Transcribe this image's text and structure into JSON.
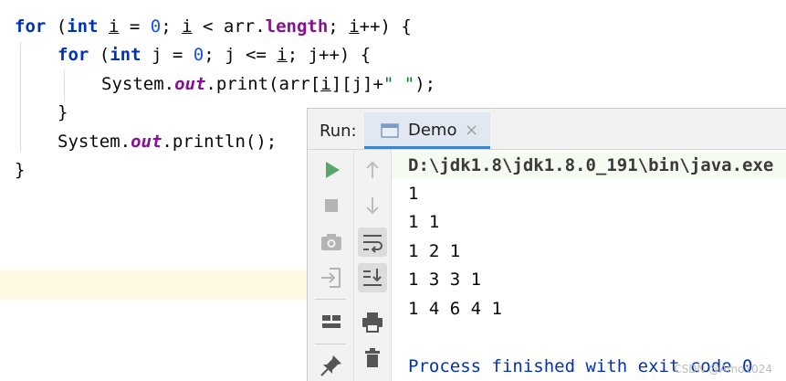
{
  "editor": {
    "line1": {
      "for_kw": "for",
      "open": " (",
      "int_kw": "int",
      "sp1": " ",
      "var_i": "i",
      "assign": " = ",
      "zero": "0",
      "semi1": "; ",
      "var_i2": "i",
      "lt": " < arr.",
      "length": "length",
      "semi2": "; ",
      "var_i3": "i",
      "rest": "++) {"
    },
    "line2": {
      "for_kw": "for",
      "open": " (",
      "int_kw": "int",
      "decl": " j = ",
      "zero": "0",
      "cond": "; j <= ",
      "var_i": "i",
      "rest": "; j++) {"
    },
    "line3": {
      "prefix": "System.",
      "out": "out",
      "mid1": ".print(arr[",
      "var_i": "i",
      "mid2": "][j]+",
      "str": "\" \"",
      "rest": ");"
    },
    "line4": "}",
    "line5": {
      "prefix": "System.",
      "out": "out",
      "rest": ".println();"
    },
    "line6": "}"
  },
  "run_window": {
    "title": "Run:",
    "tab_label": "Demo",
    "tab_close": "×",
    "console": {
      "command": "D:\\jdk1.8\\jdk1.8.0_191\\bin\\java.exe",
      "output": [
        "1",
        "1 1",
        "1 2 1",
        "1 3 3 1",
        "1 4 6 4 1"
      ],
      "exit_message": "Process finished with exit code 0"
    },
    "watermark": "CSDN @Amo1024"
  },
  "colors": {
    "keyword": "#0033b3",
    "number": "#1750eb",
    "field": "#871094",
    "string": "#067d17",
    "run_icon": "#59a869",
    "tab_underline": "#4083c9"
  },
  "icons": {
    "toolbar_left": [
      "play-icon",
      "stop-icon",
      "camera-icon",
      "login-icon",
      "layout-icon",
      "pin-icon"
    ],
    "toolbar_right": [
      "arrow-up-icon",
      "arrow-down-icon",
      "soft-wrap-icon",
      "scroll-to-end-icon",
      "print-icon",
      "trash-icon"
    ]
  }
}
